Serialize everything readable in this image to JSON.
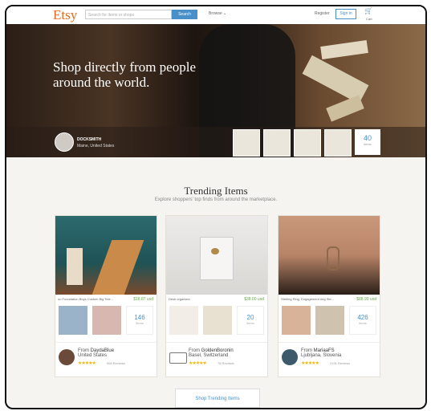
{
  "header": {
    "logo": "Etsy",
    "search_placeholder": "Search for items or shops",
    "search_button": "Search",
    "browse": "Browse ⌄",
    "register": "Register",
    "signin": "Sign in",
    "cart": "Cart"
  },
  "hero": {
    "title": "Shop directly from people around the world.",
    "shop_name": "DOCKSMITH",
    "shop_location": "Maine, United States",
    "more_count": "40",
    "more_label": "items"
  },
  "trending": {
    "title": "Trending Items",
    "subtitle": "Explore shoppers' top finds from around the marketplace.",
    "cards": [
      {
        "caption": "ou Foundation Boys Custom Big Tele...",
        "price": "$18.87 usd",
        "count": "146",
        "count_label": "items",
        "from_label": "From",
        "shop": "DaydaBlue",
        "location": "United States",
        "stars": "★★★★★",
        "reviews": "566 Reviews"
      },
      {
        "caption": "Desk organizer",
        "price": "$38.00 usd",
        "count": "20",
        "count_label": "items",
        "from_label": "From",
        "shop": "GoldenBoronin",
        "location": "Basel, Switzerland",
        "stars": "★★★★★",
        "reviews": "78 Reviews"
      },
      {
        "caption": "Sterling Ring, Engagement ring Ste...",
        "price": "$88.99 usd",
        "count": "426",
        "count_label": "items",
        "from_label": "From",
        "shop": "MariaaFS",
        "location": "Ljubljana, Slovenia",
        "stars": "★★★★★",
        "reviews": "2191 Reviews"
      }
    ],
    "button": "Shop Trending Items"
  }
}
